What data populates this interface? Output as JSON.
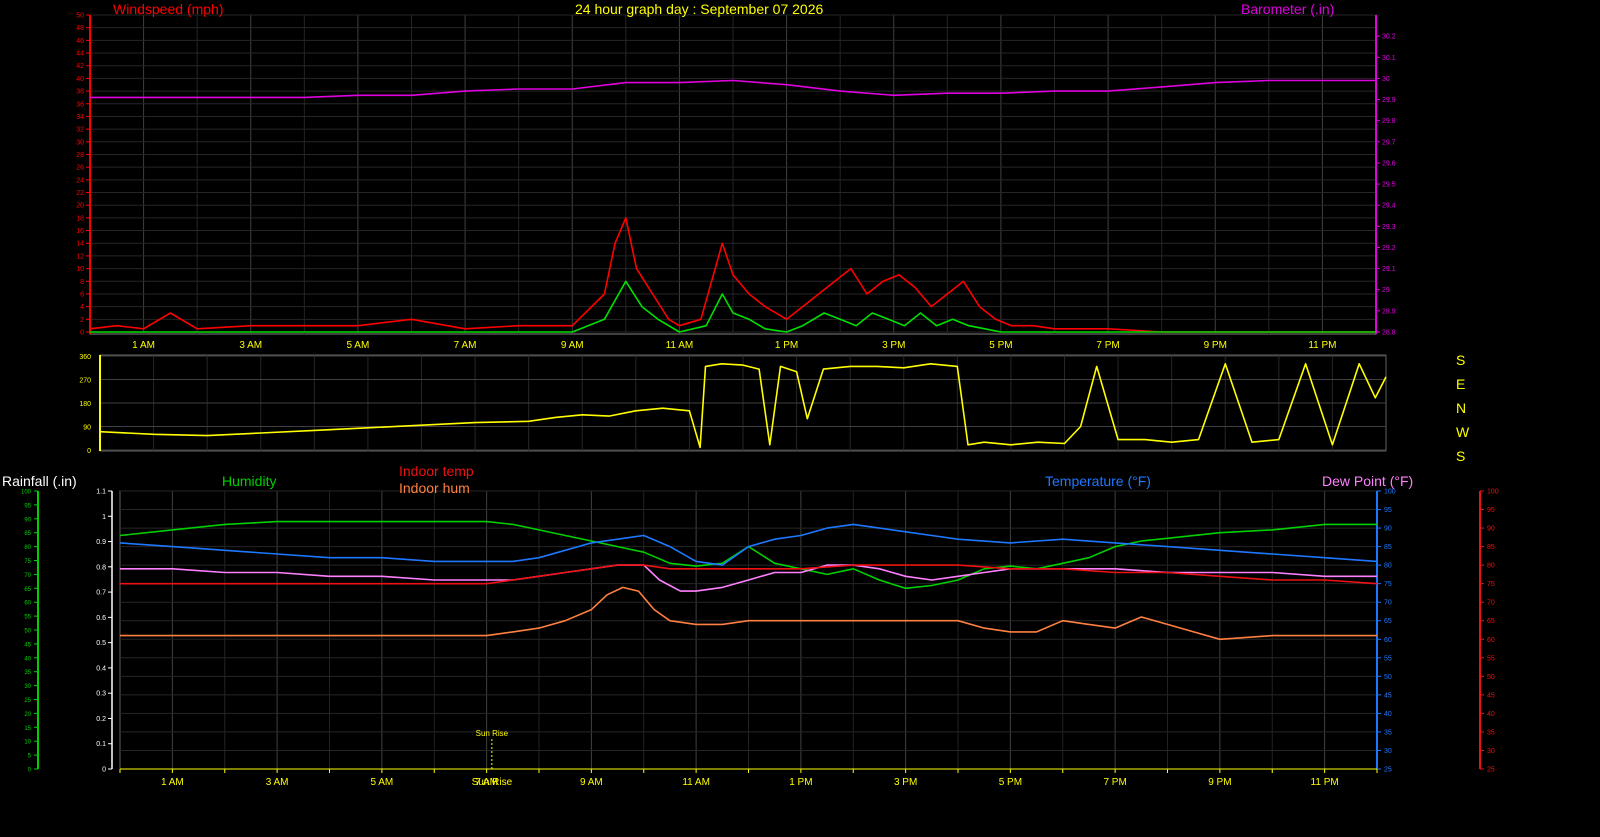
{
  "header": {
    "title": "24 hour graph day : September 07 2026",
    "windspeed_label": "Windspeed (mph)",
    "barometer_label": "Barometer (.in)"
  },
  "lower_header": {
    "rainfall_label": "Rainfall (.in)",
    "humidity_label": "Humidity",
    "indoor_temp_label": "Indoor temp",
    "indoor_hum_label": "Indoor hum",
    "temperature_label": "Temperature (°F)",
    "dewpoint_label": "Dew Point (°F)"
  },
  "compass": [
    "S",
    "E",
    "N",
    "W",
    "S"
  ],
  "colors": {
    "windspeed": "#ff0000",
    "wind_gust": "#00e000",
    "barometer": "#e000e0",
    "direction": "#ffff00",
    "humidity": "#00d000",
    "temperature": "#1e78ff",
    "dewpoint": "#ff80ff",
    "indoor_temp": "#ee1111",
    "indoor_hum": "#ff8040",
    "time_axis": "#ffff00",
    "grid": "#404040"
  },
  "chart_data": [
    {
      "type": "line",
      "name": "wind-baro",
      "title": "24 hour graph day : September 07 2026",
      "xlabel": "",
      "x_ticks": [
        "1 AM",
        "3 AM",
        "5 AM",
        "7 AM",
        "9 AM",
        "11 AM",
        "1 PM",
        "3 PM",
        "5 PM",
        "7 PM",
        "9 PM",
        "11 PM"
      ],
      "left_axis": {
        "label": "Windspeed (mph)",
        "ylim": [
          0,
          50
        ],
        "ticks": [
          0,
          2,
          4,
          6,
          8,
          10,
          12,
          14,
          16,
          18,
          20,
          22,
          24,
          26,
          28,
          30,
          32,
          34,
          36,
          38,
          40,
          42,
          44,
          46,
          48,
          50
        ]
      },
      "right_axis": {
        "label": "Barometer (.in)",
        "ylim": [
          28.8,
          30.3
        ],
        "ticks": [
          28.8,
          28.9,
          29.0,
          29.1,
          29.2,
          29.3,
          29.4,
          29.5,
          29.6,
          29.7,
          29.8,
          29.9,
          30.0,
          30.1,
          30.2
        ]
      },
      "series": [
        {
          "key": "barometer",
          "axis": "right",
          "x": [
            0,
            1,
            2,
            3,
            4,
            5,
            6,
            7,
            8,
            9,
            10,
            11,
            12,
            13,
            14,
            15,
            16,
            17,
            18,
            19,
            20,
            21,
            22,
            23,
            24
          ],
          "values": [
            29.91,
            29.91,
            29.91,
            29.91,
            29.91,
            29.92,
            29.92,
            29.94,
            29.95,
            29.95,
            29.98,
            29.98,
            29.99,
            29.97,
            29.94,
            29.92,
            29.93,
            29.93,
            29.94,
            29.94,
            29.96,
            29.98,
            29.99,
            29.99,
            29.99
          ]
        },
        {
          "key": "windspeed",
          "axis": "left",
          "x": [
            0,
            0.5,
            1,
            1.5,
            2,
            3,
            4,
            5,
            6,
            7,
            8,
            9,
            9.6,
            9.8,
            10,
            10.2,
            10.5,
            10.8,
            11,
            11.4,
            11.6,
            11.8,
            12,
            12.3,
            12.6,
            13,
            13.3,
            13.6,
            13.9,
            14.2,
            14.5,
            14.8,
            15.1,
            15.4,
            15.7,
            16,
            16.3,
            16.6,
            16.9,
            17.2,
            17.6,
            18,
            19,
            20,
            21,
            22,
            23,
            24
          ],
          "values": [
            0.5,
            1,
            0.5,
            3,
            0.5,
            1,
            1,
            1,
            2,
            0.5,
            1,
            1,
            6,
            14,
            18,
            10,
            6,
            2,
            1,
            2,
            8,
            14,
            9,
            6,
            4,
            2,
            4,
            6,
            8,
            10,
            6,
            8,
            9,
            7,
            4,
            6,
            8,
            4,
            2,
            1,
            1,
            0.5,
            0.5,
            0,
            0,
            0,
            0,
            0
          ]
        },
        {
          "key": "wind_gust",
          "axis": "left",
          "x": [
            0,
            9,
            9.6,
            9.8,
            10,
            10.3,
            10.6,
            11,
            11.5,
            11.8,
            12,
            12.3,
            12.6,
            13,
            13.3,
            13.7,
            14,
            14.3,
            14.6,
            14.9,
            15.2,
            15.5,
            15.8,
            16.1,
            16.4,
            16.7,
            17,
            24
          ],
          "values": [
            0,
            0,
            2,
            5,
            8,
            4,
            2,
            0,
            1,
            6,
            3,
            2,
            0.5,
            0,
            1,
            3,
            2,
            1,
            3,
            2,
            1,
            3,
            1,
            2,
            1,
            0.5,
            0,
            0
          ]
        }
      ]
    },
    {
      "type": "line",
      "name": "wind-direction",
      "xlabel": "",
      "ylim": [
        0,
        360
      ],
      "y_ticks": [
        0,
        90,
        180,
        270,
        360
      ],
      "series": [
        {
          "key": "direction",
          "x": [
            0,
            1,
            2,
            3,
            4,
            5,
            6,
            7,
            8,
            8.5,
            9,
            9.5,
            10,
            10.5,
            11,
            11.2,
            11.3,
            11.6,
            12,
            12.3,
            12.5,
            12.7,
            13,
            13.2,
            13.5,
            14,
            14.5,
            15,
            15.5,
            16,
            16.2,
            16.5,
            17,
            17.5,
            18,
            18.3,
            18.6,
            19,
            19.5,
            20,
            20.5,
            21,
            21.5,
            22,
            22.5,
            23,
            23.5,
            23.8,
            24
          ],
          "values": [
            70,
            60,
            55,
            65,
            75,
            85,
            95,
            105,
            110,
            125,
            135,
            130,
            150,
            160,
            150,
            10,
            320,
            330,
            325,
            310,
            20,
            320,
            300,
            120,
            310,
            320,
            320,
            315,
            330,
            320,
            20,
            30,
            20,
            30,
            25,
            90,
            320,
            40,
            40,
            30,
            40,
            330,
            30,
            40,
            330,
            20,
            330,
            200,
            280
          ]
        }
      ]
    },
    {
      "type": "line",
      "name": "temp-humidity",
      "xlabel": "",
      "annotation": "Sun Rise",
      "sunrise_hour": 7.1,
      "rainfall_axis": {
        "label": "Rainfall (.in)",
        "ylim": [
          0,
          1.1
        ],
        "ticks": [
          0,
          0.1,
          0.2,
          0.3,
          0.4,
          0.5,
          0.6,
          0.7,
          0.8,
          0.9,
          1,
          1.1
        ]
      },
      "humidity_axis": {
        "label": "Humidity",
        "ylim": [
          0,
          100
        ],
        "ticks": [
          0,
          5,
          10,
          15,
          20,
          25,
          30,
          35,
          40,
          45,
          50,
          55,
          60,
          65,
          70,
          75,
          80,
          85,
          90,
          95,
          100
        ]
      },
      "temperature_axis": {
        "label": "Temperature (°F)",
        "ylim": [
          25,
          100
        ],
        "ticks": [
          25,
          30,
          35,
          40,
          45,
          50,
          55,
          60,
          65,
          70,
          75,
          80,
          85,
          90,
          95,
          100
        ]
      },
      "indoor_axis": {
        "label": "Indoor temp",
        "ylim": [
          25,
          100
        ],
        "ticks": [
          25,
          30,
          35,
          40,
          45,
          50,
          55,
          60,
          65,
          70,
          75,
          80,
          85,
          90,
          95,
          100
        ]
      },
      "series": [
        {
          "key": "humidity",
          "axis": "humidity",
          "x": [
            0,
            1,
            2,
            3,
            4,
            5,
            6,
            7,
            7.5,
            8,
            8.5,
            9,
            9.5,
            10,
            10.5,
            11,
            11.5,
            12,
            12.5,
            13,
            13.5,
            14,
            14.5,
            15,
            15.5,
            16,
            16.5,
            17,
            17.5,
            18,
            18.5,
            19,
            19.5,
            20,
            21,
            22,
            23,
            24
          ],
          "values": [
            84,
            86,
            88,
            89,
            89,
            89,
            89,
            89,
            88,
            86,
            84,
            82,
            80,
            78,
            74,
            73,
            74,
            80,
            74,
            72,
            70,
            72,
            68,
            65,
            66,
            68,
            72,
            73,
            72,
            74,
            76,
            80,
            82,
            83,
            85,
            86,
            88,
            88
          ]
        },
        {
          "key": "temperature",
          "axis": "temperature",
          "x": [
            0,
            1,
            2,
            3,
            4,
            5,
            6,
            7,
            7.5,
            8,
            8.5,
            9,
            9.5,
            10,
            10.5,
            11,
            11.5,
            12,
            12.5,
            13,
            13.5,
            14,
            14.5,
            15,
            15.5,
            16,
            17,
            18,
            19,
            20,
            21,
            22,
            23,
            24
          ],
          "values": [
            86,
            85,
            84,
            83,
            82,
            82,
            81,
            81,
            81,
            82,
            84,
            86,
            87,
            88,
            85,
            81,
            80,
            85,
            87,
            88,
            90,
            91,
            90,
            89,
            88,
            87,
            86,
            87,
            86,
            85,
            84,
            83,
            82,
            81
          ]
        },
        {
          "key": "dewpoint",
          "axis": "temperature",
          "x": [
            0,
            1,
            2,
            3,
            4,
            5,
            6,
            7,
            7.5,
            8,
            8.5,
            9,
            9.5,
            10,
            10.3,
            10.7,
            11,
            11.5,
            12,
            12.5,
            13,
            13.5,
            14,
            14.5,
            15,
            15.5,
            16,
            16.5,
            17,
            18,
            19,
            20,
            21,
            22,
            23,
            24
          ],
          "values": [
            79,
            79,
            78,
            78,
            77,
            77,
            76,
            76,
            76,
            77,
            78,
            79,
            80,
            80,
            76,
            73,
            73,
            74,
            76,
            78,
            78,
            80,
            80,
            79,
            77,
            76,
            77,
            78,
            79,
            79,
            79,
            78,
            78,
            78,
            77,
            77
          ]
        },
        {
          "key": "indoor_temp",
          "axis": "indoor",
          "x": [
            0,
            1,
            2,
            3,
            4,
            5,
            6,
            7,
            7.5,
            8,
            8.5,
            9,
            9.5,
            10,
            10.5,
            11,
            12,
            13,
            14,
            15,
            16,
            17,
            18,
            19,
            20,
            21,
            22,
            23,
            24
          ],
          "values": [
            75,
            75,
            75,
            75,
            75,
            75,
            75,
            75,
            76,
            77,
            78,
            79,
            80,
            80,
            79,
            79,
            79,
            79,
            80,
            80,
            80,
            79,
            79,
            78,
            78,
            77,
            76,
            76,
            75
          ]
        },
        {
          "key": "indoor_hum",
          "axis": "indoor",
          "x": [
            0,
            1,
            2,
            3,
            4,
            5,
            6,
            7,
            7.5,
            8,
            8.5,
            9,
            9.3,
            9.6,
            9.9,
            10.2,
            10.5,
            11,
            11.5,
            12,
            13,
            14,
            15,
            16,
            16.5,
            17,
            17.5,
            18,
            18.5,
            19,
            19.5,
            20,
            20.5,
            21,
            22,
            23,
            24
          ],
          "values": [
            61,
            61,
            61,
            61,
            61,
            61,
            61,
            61,
            62,
            63,
            65,
            68,
            72,
            74,
            73,
            68,
            65,
            64,
            64,
            65,
            65,
            65,
            65,
            65,
            63,
            62,
            62,
            65,
            64,
            63,
            66,
            64,
            62,
            60,
            61,
            61,
            61
          ]
        }
      ]
    }
  ]
}
